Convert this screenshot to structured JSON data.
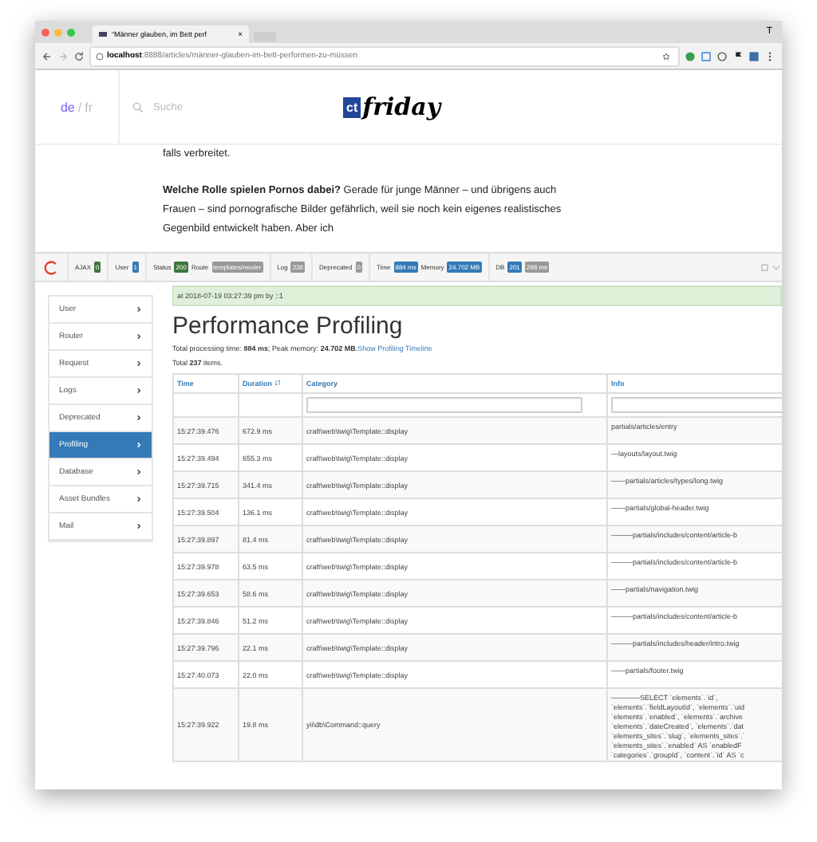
{
  "browser": {
    "tab_title": "“Männer glauben, im Bett perf",
    "tab_close": "×",
    "profile": "T",
    "url_host": "localhost",
    "url_rest": ":8888/articles/männer-glauben-im-bett-performen-zu-müssen"
  },
  "site_header": {
    "lang_active": "de",
    "lang_sep": "/",
    "lang_other": "fr",
    "search_placeholder": "Suche",
    "logo_mark": "ct",
    "logo_word": "friday"
  },
  "article": {
    "lines": [
      "falls verbreitet."
    ],
    "paragraph": "**Welche Rolle spielen Pornos dabei?** Gerade für junge Männer – und übrigens auch Frauen – sind pornografische Bilder gefährlich, weil sie noch kein eigenes realistisches Gegenbild entwickelt haben. Aber ich"
  },
  "debug_toolbar": {
    "groups": [
      {
        "items": [
          {
            "label": "AJAX",
            "badge": "0",
            "color": "#3c763d"
          }
        ]
      },
      {
        "items": [
          {
            "label": "User",
            "badge": "1",
            "color": "#337ab7"
          }
        ]
      },
      {
        "items": [
          {
            "label": "Status",
            "badge": "200",
            "color": "#3c763d"
          },
          {
            "label": "Route",
            "badge": "templates/render",
            "color": "#999999"
          }
        ]
      },
      {
        "items": [
          {
            "label": "Log",
            "badge": "226",
            "color": "#999999"
          }
        ]
      },
      {
        "items": [
          {
            "label": "Deprecated",
            "badge": "0",
            "color": "#999999"
          }
        ]
      },
      {
        "items": [
          {
            "label": "Time",
            "badge": "884 ms",
            "color": "#337ab7"
          },
          {
            "label": "Memory",
            "badge": "24.702 MB",
            "color": "#337ab7"
          }
        ]
      },
      {
        "items": [
          {
            "label": "DB",
            "badge": "201",
            "color": "#337ab7"
          },
          {
            "badge": "298 ms",
            "color": "#999999"
          }
        ]
      }
    ]
  },
  "panel": {
    "request_info": "at 2018-07-19 03:27:39 pm by ::1",
    "sidebar": [
      {
        "label": "User",
        "selected": false
      },
      {
        "label": "Router",
        "selected": false
      },
      {
        "label": "Request",
        "selected": false
      },
      {
        "label": "Logs",
        "selected": false
      },
      {
        "label": "Deprecated",
        "selected": false
      },
      {
        "label": "Profiling",
        "selected": true
      },
      {
        "label": "Database",
        "selected": false
      },
      {
        "label": "Asset Bundles",
        "selected": false
      },
      {
        "label": "Mail",
        "selected": false
      }
    ],
    "title": "Performance Profiling",
    "summary": "Total processing time: **884 ms**; Peak memory: **24.702 MB**.",
    "timeline_link": "Show Profiling Timeline",
    "total": "Total **237** items.",
    "table": {
      "columns": [
        "Time",
        "Duration",
        "Category",
        "Info"
      ],
      "rows": [
        {
          "time": "15:27:39.476",
          "duration": "672.9 ms",
          "category": "craft\\web\\twig\\Template::display",
          "info": [
            "partials/articles/entry"
          ]
        },
        {
          "time": "15:27:39.494",
          "duration": "655.3 ms",
          "category": "craft\\web\\twig\\Template::display",
          "info": [
            "—layouts/layout.twig"
          ]
        },
        {
          "time": "15:27:39.715",
          "duration": "341.4 ms",
          "category": "craft\\web\\twig\\Template::display",
          "info": [
            "——partials/articles/types/long.twig"
          ]
        },
        {
          "time": "15:27:39.504",
          "duration": "136.1 ms",
          "category": "craft\\web\\twig\\Template::display",
          "info": [
            "——partials/global-header.twig"
          ]
        },
        {
          "time": "15:27:39.897",
          "duration": "81.4 ms",
          "category": "craft\\web\\twig\\Template::display",
          "info": [
            "———partials/includes/content/article-b"
          ]
        },
        {
          "time": "15:27:39.978",
          "duration": "63.5 ms",
          "category": "craft\\web\\twig\\Template::display",
          "info": [
            "———partials/includes/content/article-b"
          ]
        },
        {
          "time": "15:27:39.653",
          "duration": "58.6 ms",
          "category": "craft\\web\\twig\\Template::display",
          "info": [
            "——partials/navigation.twig"
          ]
        },
        {
          "time": "15:27:39.846",
          "duration": "51.2 ms",
          "category": "craft\\web\\twig\\Template::display",
          "info": [
            "———partials/includes/content/article-b"
          ]
        },
        {
          "time": "15:27:39.796",
          "duration": "22.1 ms",
          "category": "craft\\web\\twig\\Template::display",
          "info": [
            "———partials/includes/header/intro.twig"
          ]
        },
        {
          "time": "15:27:40.073",
          "duration": "22.0 ms",
          "category": "craft\\web\\twig\\Template::display",
          "info": [
            "——partials/footer.twig"
          ]
        },
        {
          "time": "15:27:39.922",
          "duration": "19.8 ms",
          "category": "yii\\db\\Command::query",
          "info": [
            "————SELECT `elements`.`id`,",
            "`elements`.`fieldLayoutId`, `elements`.`uid",
            "`elements`.`enabled`, `elements`.`archive",
            "`elements`.`dateCreated`, `elements`.`dat",
            "`elements_sites`.`slug`, `elements_sites`.`",
            "`elements_sites`.`enabled` AS `enabledF",
            "`categories`.`groupId`, `content`.`id` AS `c"
          ]
        }
      ]
    }
  }
}
